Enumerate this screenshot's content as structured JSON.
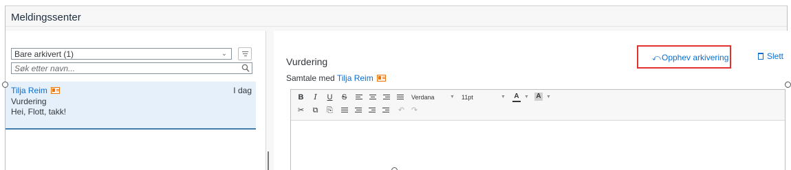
{
  "header": {
    "title": "Meldingssenter"
  },
  "left": {
    "filter_value": "Bare arkivert (1)",
    "search_placeholder": "Søk etter navn...",
    "conversation": {
      "name": "Tilja Reim",
      "date": "I dag",
      "subject": "Vurdering",
      "preview": "Hei,  Flott, takk!"
    }
  },
  "right": {
    "title": "Vurdering",
    "with_prefix": "Samtale med ",
    "with_name": "Tilja Reim",
    "unarchive_label": "Opphev arkivering",
    "delete_label": "Slett"
  },
  "editor": {
    "font_family": "Verdana",
    "font_size": "11pt",
    "text_color_label": "A",
    "highlight_label": "A"
  },
  "icons": {
    "unarchive": "undo-arrow-icon",
    "delete": "trash-icon",
    "contact": "contact-card-icon"
  },
  "colors": {
    "link": "#0a6ed1",
    "highlight_box": "#e03030",
    "selected_row": "#e5f0fa",
    "vcard": "#e9730c"
  }
}
